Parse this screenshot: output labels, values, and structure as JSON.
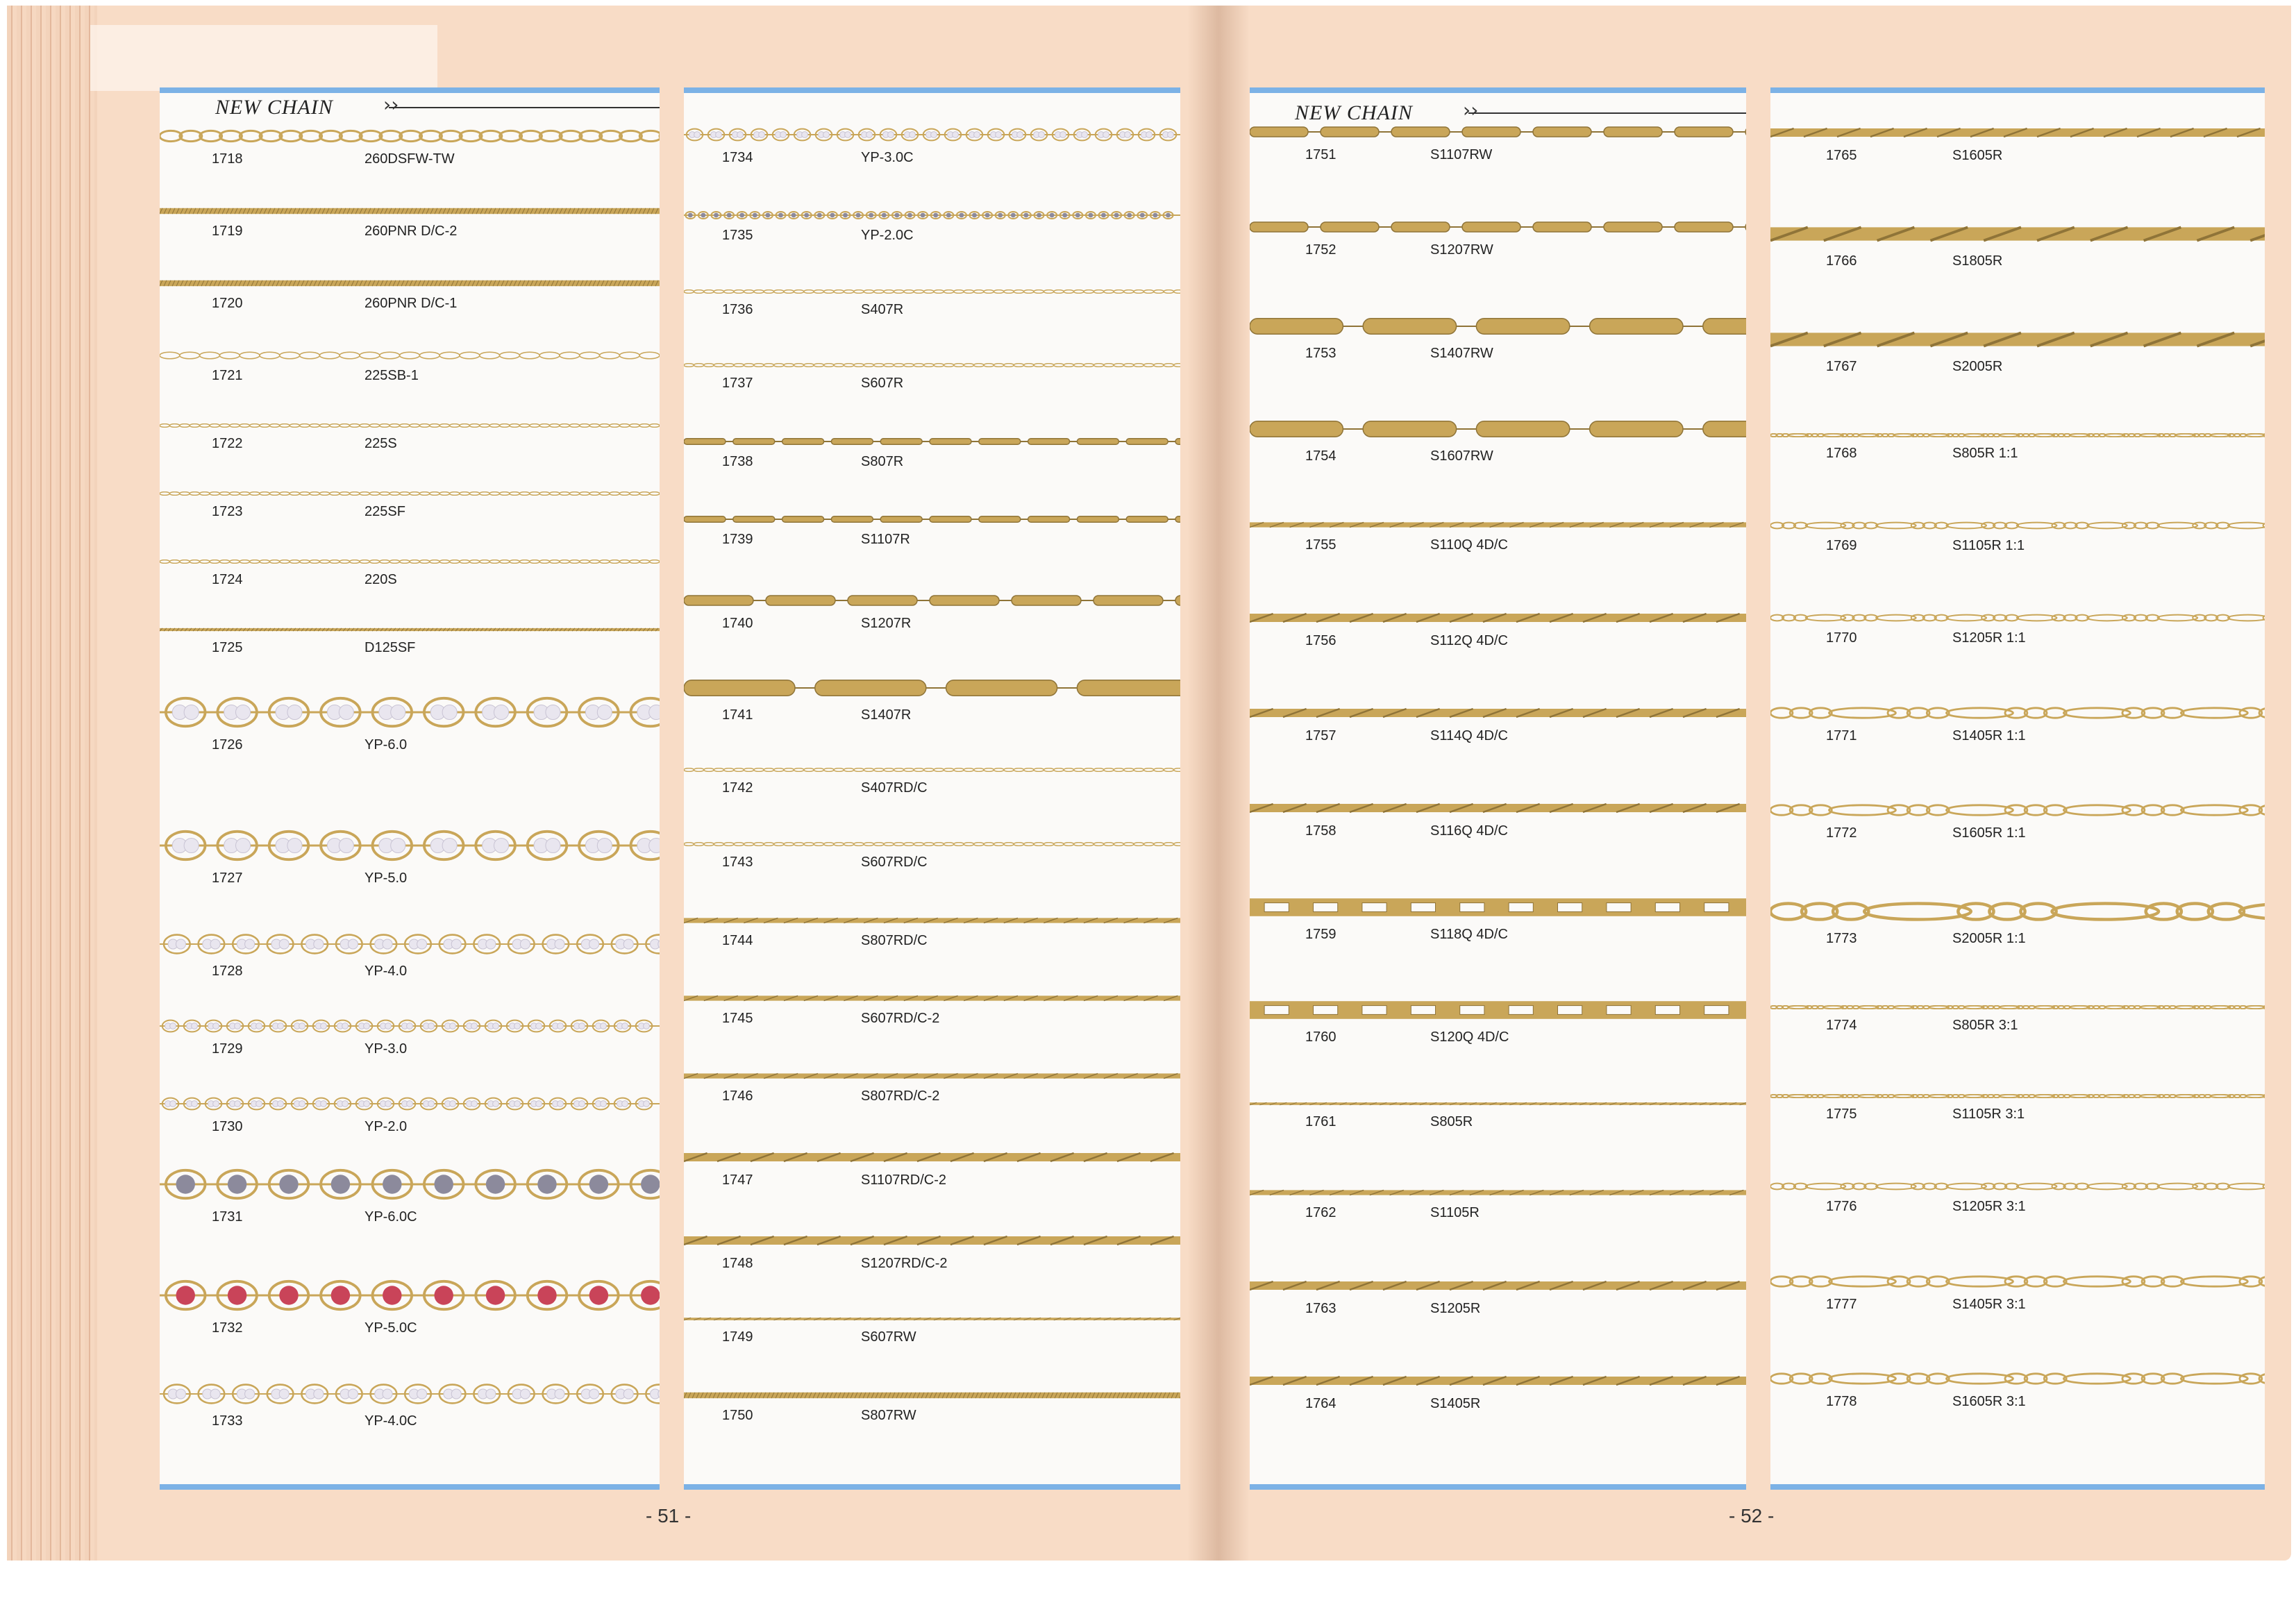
{
  "heading": "NEW CHAIN",
  "colors": {
    "gold": "#c9a659",
    "gold_dark": "#8f7438",
    "page": "#f8dcc6",
    "panel": "#fbfaf8",
    "accent": "#7cb2e6",
    "pearl": "#e9e6ef",
    "pearl_grey": "#8c8a9c",
    "pearl_red": "#c94459"
  },
  "pages": {
    "left": "- 51 -",
    "right": "- 52 -"
  },
  "columns": [
    {
      "items": [
        {
          "code": "1718",
          "name": "260DSFW-TW",
          "style": "oval",
          "thick": "m"
        },
        {
          "code": "1719",
          "name": "260PNR D/C-2",
          "style": "rope",
          "thick": "s"
        },
        {
          "code": "1720",
          "name": "260PNR D/C-1",
          "style": "rope",
          "thick": "s"
        },
        {
          "code": "1721",
          "name": "225SB-1",
          "style": "fine",
          "thick": "s"
        },
        {
          "code": "1722",
          "name": "225S",
          "style": "fine",
          "thick": "xs"
        },
        {
          "code": "1723",
          "name": "225SF",
          "style": "fine",
          "thick": "xs"
        },
        {
          "code": "1724",
          "name": "220S",
          "style": "fine",
          "thick": "xs"
        },
        {
          "code": "1725",
          "name": "D125SF",
          "style": "rope",
          "thick": "xs"
        },
        {
          "code": "1726",
          "name": "YP-6.0",
          "style": "pearl",
          "pearl": "white",
          "thick": "xl"
        },
        {
          "code": "1727",
          "name": "YP-5.0",
          "style": "pearl",
          "pearl": "white",
          "thick": "xl"
        },
        {
          "code": "1728",
          "name": "YP-4.0",
          "style": "pearl",
          "pearl": "white",
          "thick": "l"
        },
        {
          "code": "1729",
          "name": "YP-3.0",
          "style": "pearl",
          "pearl": "white",
          "thick": "m"
        },
        {
          "code": "1730",
          "name": "YP-2.0",
          "style": "pearl",
          "pearl": "white",
          "thick": "m"
        },
        {
          "code": "1731",
          "name": "YP-6.0C",
          "style": "pearl",
          "pearl": "grey",
          "thick": "xl"
        },
        {
          "code": "1732",
          "name": "YP-5.0C",
          "style": "pearl",
          "pearl": "red",
          "thick": "xl"
        },
        {
          "code": "1733",
          "name": "YP-4.0C",
          "style": "pearl",
          "pearl": "white",
          "thick": "l"
        }
      ]
    },
    {
      "items": [
        {
          "code": "1734",
          "name": "YP-3.0C",
          "style": "pearl",
          "pearl": "white",
          "thick": "m"
        },
        {
          "code": "1735",
          "name": "YP-2.0C",
          "style": "pearl",
          "pearl": "grey",
          "thick": "s"
        },
        {
          "code": "1736",
          "name": "S407R",
          "style": "fine",
          "thick": "xs"
        },
        {
          "code": "1737",
          "name": "S607R",
          "style": "fine",
          "thick": "xs"
        },
        {
          "code": "1738",
          "name": "S807R",
          "style": "bar",
          "thick": "s"
        },
        {
          "code": "1739",
          "name": "S1107R",
          "style": "bar",
          "thick": "s"
        },
        {
          "code": "1740",
          "name": "S1207R",
          "style": "bar",
          "thick": "m"
        },
        {
          "code": "1741",
          "name": "S1407R",
          "style": "bar",
          "thick": "l"
        },
        {
          "code": "1742",
          "name": "S407RD/C",
          "style": "fine",
          "thick": "xs"
        },
        {
          "code": "1743",
          "name": "S607RD/C",
          "style": "fine",
          "thick": "xs"
        },
        {
          "code": "1744",
          "name": "S807RD/C",
          "style": "twist",
          "thick": "s"
        },
        {
          "code": "1745",
          "name": "S607RD/C-2",
          "style": "twist",
          "thick": "s"
        },
        {
          "code": "1746",
          "name": "S807RD/C-2",
          "style": "twist",
          "thick": "s"
        },
        {
          "code": "1747",
          "name": "S1107RD/C-2",
          "style": "twist",
          "thick": "m"
        },
        {
          "code": "1748",
          "name": "S1207RD/C-2",
          "style": "twist",
          "thick": "m"
        },
        {
          "code": "1749",
          "name": "S607RW",
          "style": "twist",
          "thick": "xs"
        },
        {
          "code": "1750",
          "name": "S807RW",
          "style": "rope",
          "thick": "s"
        }
      ]
    },
    {
      "items": [
        {
          "code": "1751",
          "name": "S1107RW",
          "style": "capsule",
          "thick": "m"
        },
        {
          "code": "1752",
          "name": "S1207RW",
          "style": "capsule",
          "thick": "m"
        },
        {
          "code": "1753",
          "name": "S1407RW",
          "style": "capsule",
          "thick": "l"
        },
        {
          "code": "1754",
          "name": "S1607RW",
          "style": "capsule",
          "thick": "l"
        },
        {
          "code": "1755",
          "name": "S110Q 4D/C",
          "style": "twist",
          "thick": "s"
        },
        {
          "code": "1756",
          "name": "S112Q 4D/C",
          "style": "twist",
          "thick": "m"
        },
        {
          "code": "1757",
          "name": "S114Q 4D/C",
          "style": "twist",
          "thick": "m"
        },
        {
          "code": "1758",
          "name": "S116Q 4D/C",
          "style": "twist",
          "thick": "m"
        },
        {
          "code": "1759",
          "name": "S118Q 4D/C",
          "style": "mariner",
          "thick": "l"
        },
        {
          "code": "1760",
          "name": "S120Q 4D/C",
          "style": "mariner",
          "thick": "l"
        },
        {
          "code": "1761",
          "name": "S805R",
          "style": "twist",
          "thick": "xs"
        },
        {
          "code": "1762",
          "name": "S1105R",
          "style": "twist",
          "thick": "s"
        },
        {
          "code": "1763",
          "name": "S1205R",
          "style": "twist",
          "thick": "m"
        },
        {
          "code": "1764",
          "name": "S1405R",
          "style": "twist",
          "thick": "m"
        }
      ]
    },
    {
      "items": [
        {
          "code": "1765",
          "name": "S1605R",
          "style": "twist",
          "thick": "m"
        },
        {
          "code": "1766",
          "name": "S1805R",
          "style": "twist",
          "thick": "l"
        },
        {
          "code": "1767",
          "name": "S2005R",
          "style": "twist",
          "thick": "l"
        },
        {
          "code": "1768",
          "name": "S805R 1:1",
          "style": "figaro",
          "thick": "xs"
        },
        {
          "code": "1769",
          "name": "S1105R 1:1",
          "style": "figaro",
          "thick": "s"
        },
        {
          "code": "1770",
          "name": "S1205R 1:1",
          "style": "figaro",
          "thick": "s"
        },
        {
          "code": "1771",
          "name": "S1405R 1:1",
          "style": "figaro",
          "thick": "m"
        },
        {
          "code": "1772",
          "name": "S1605R 1:1",
          "style": "figaro",
          "thick": "m"
        },
        {
          "code": "1773",
          "name": "S2005R 1:1",
          "style": "figaro",
          "thick": "l"
        },
        {
          "code": "1774",
          "name": "S805R 3:1",
          "style": "figaro",
          "thick": "xs"
        },
        {
          "code": "1775",
          "name": "S1105R 3:1",
          "style": "figaro",
          "thick": "xs"
        },
        {
          "code": "1776",
          "name": "S1205R 3:1",
          "style": "figaro",
          "thick": "s"
        },
        {
          "code": "1777",
          "name": "S1405R 3:1",
          "style": "figaro",
          "thick": "m"
        },
        {
          "code": "1778",
          "name": "S1605R 3:1",
          "style": "figaro",
          "thick": "m"
        }
      ]
    }
  ]
}
